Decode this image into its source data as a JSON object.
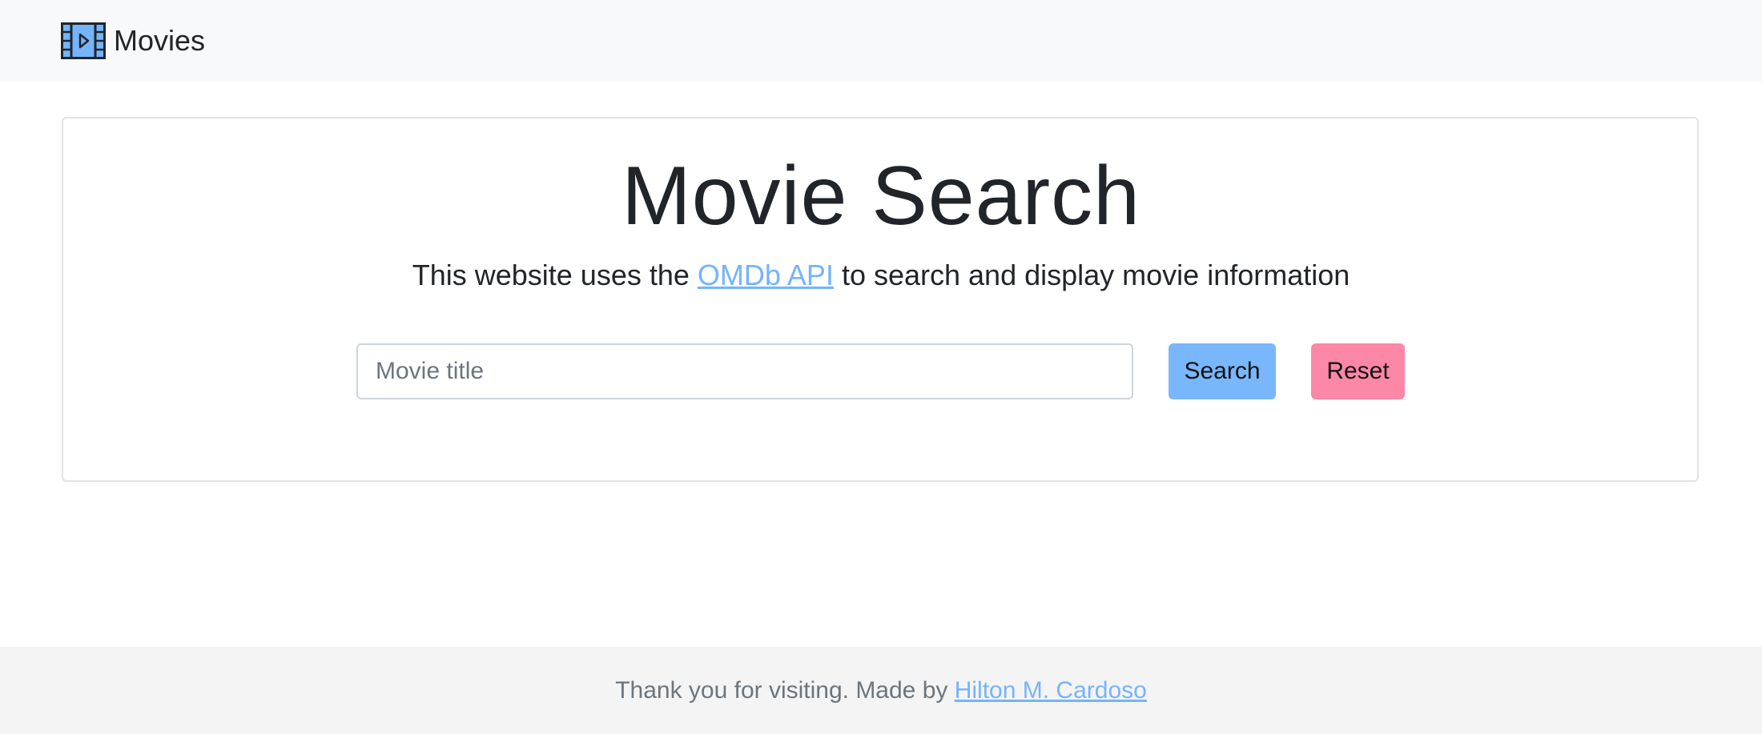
{
  "navbar": {
    "brand_icon": "film-icon",
    "brand_label": "Movies"
  },
  "jumbotron": {
    "title": "Movie Search",
    "lead_prefix": "This website uses the ",
    "lead_link": "OMDb API",
    "lead_suffix": " to search and display movie information"
  },
  "search": {
    "placeholder": "Movie title",
    "value": "",
    "search_label": "Search",
    "reset_label": "Reset"
  },
  "footer": {
    "text_prefix": "Thank you for visiting. Made by ",
    "author_link": "Hilton M. Cardoso"
  },
  "colors": {
    "link": "#74b4fc",
    "search_button": "#79b7fd",
    "reset_button": "#fd87a7",
    "navbar_bg": "#f8f9fa",
    "footer_bg": "#f4f4f4"
  }
}
